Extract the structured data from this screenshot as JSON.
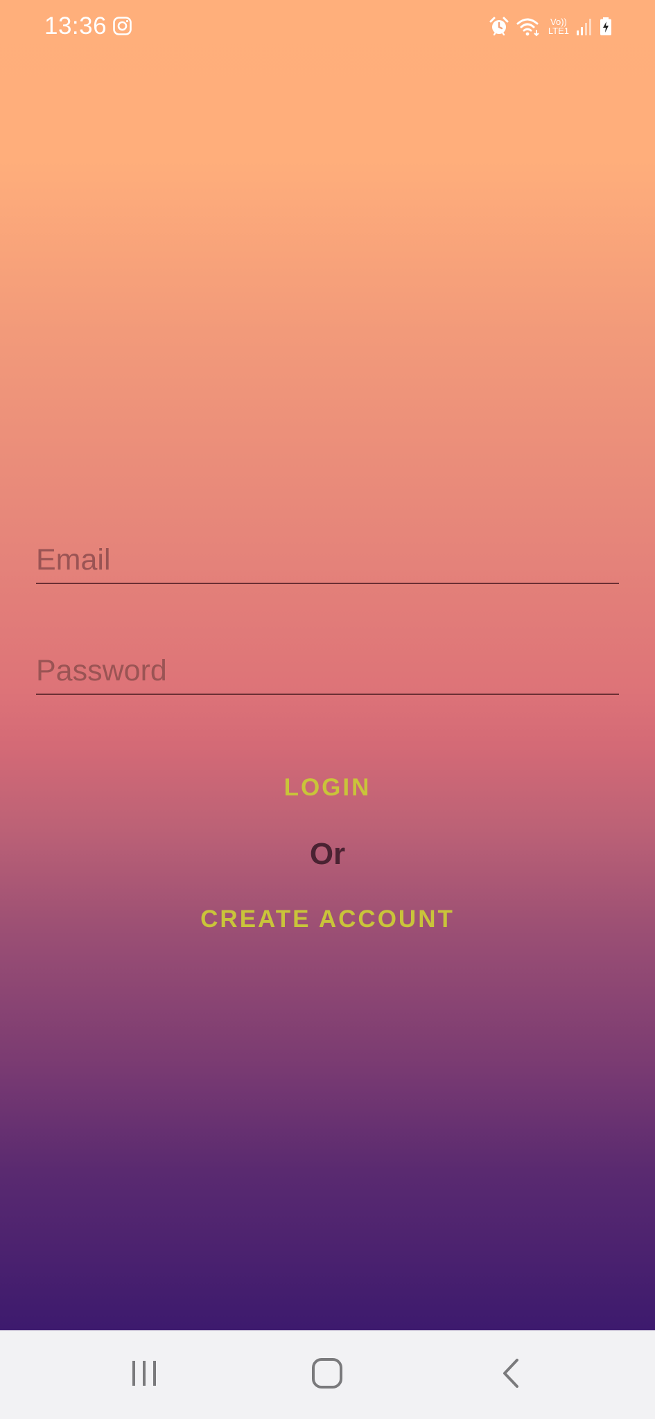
{
  "status_bar": {
    "time": "13:36",
    "network_label_top": "Vo))",
    "network_label_bottom": "LTE1",
    "icons": [
      "instagram-icon",
      "alarm-icon",
      "wifi-icon",
      "volte-icon",
      "signal-icon",
      "battery-charging-icon"
    ]
  },
  "form": {
    "email_placeholder": "Email",
    "email_value": "",
    "password_placeholder": "Password",
    "password_value": ""
  },
  "actions": {
    "login_label": "LOGIN",
    "or_label": "Or",
    "create_account_label": "CREATE ACCOUNT"
  },
  "nav_bar": {
    "icons": [
      "recents-icon",
      "home-icon",
      "back-icon"
    ]
  },
  "colors": {
    "gradient_top": "#ffaf7b",
    "gradient_middle": "#d76d77",
    "gradient_bottom": "#3a1c71",
    "button_text": "#c9c43a",
    "or_text": "#4a2232",
    "nav_background": "#f2f2f4"
  }
}
